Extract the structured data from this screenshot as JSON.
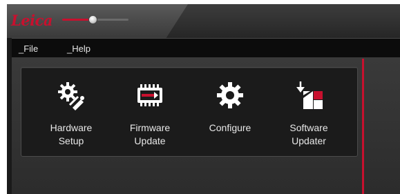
{
  "app": {
    "logo_text": "Leica"
  },
  "menu": {
    "items": [
      {
        "label": "_File"
      },
      {
        "label": "_Help"
      }
    ]
  },
  "tools": [
    {
      "line1": "Hardware",
      "line2": "Setup",
      "icon": "hardware-setup-icon"
    },
    {
      "line1": "Firmware",
      "line2": "Update",
      "icon": "firmware-update-icon"
    },
    {
      "line1": "Configure",
      "line2": "",
      "icon": "configure-icon"
    },
    {
      "line1": "Software",
      "line2": "Updater",
      "icon": "software-updater-icon"
    }
  ],
  "slider": {
    "value_fraction": 0.45
  },
  "colors": {
    "accent": "#c8102e",
    "panel": "#1b1b1b",
    "text": "#e8e8e8"
  }
}
